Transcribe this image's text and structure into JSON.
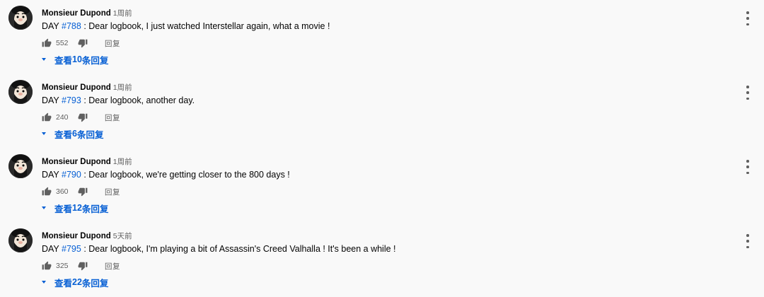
{
  "comments": [
    {
      "author": "Monsieur Dupond",
      "time": "1周前",
      "text_prefix": "DAY ",
      "day_link": "#788",
      "text_body": " : Dear logbook, I just watched Interstellar again, what a movie !",
      "likes": "552",
      "reply_label": "回复",
      "replies_prefix": "查看 ",
      "replies_count": "10",
      "replies_suffix": " 条回复"
    },
    {
      "author": "Monsieur Dupond",
      "time": "1周前",
      "text_prefix": "DAY ",
      "day_link": "#793",
      "text_body": " : Dear logbook, another day.",
      "likes": "240",
      "reply_label": "回复",
      "replies_prefix": "查看 ",
      "replies_count": "6",
      "replies_suffix": " 条回复"
    },
    {
      "author": "Monsieur Dupond",
      "time": "1周前",
      "text_prefix": "DAY ",
      "day_link": "#790",
      "text_body": " : Dear logbook, we're getting closer to the 800 days !",
      "likes": "360",
      "reply_label": "回复",
      "replies_prefix": "查看 ",
      "replies_count": "12",
      "replies_suffix": " 条回复"
    },
    {
      "author": "Monsieur Dupond",
      "time": "5天前",
      "text_prefix": "DAY ",
      "day_link": "#795",
      "text_body": " : Dear logbook, I'm playing a bit of Assassin's Creed Valhalla ! It's been a while !",
      "likes": "325",
      "reply_label": "回复",
      "replies_prefix": "查看 ",
      "replies_count": "22",
      "replies_suffix": " 条回复"
    }
  ],
  "icons": {
    "like": "thumb-up-icon",
    "dislike": "thumb-down-icon",
    "menu": "more-vert-icon",
    "expand": "caret-down-icon",
    "avatar": "avatar-image"
  },
  "colors": {
    "link": "#065fd4",
    "secondary_text": "#606060",
    "background": "#f9f9f9"
  }
}
